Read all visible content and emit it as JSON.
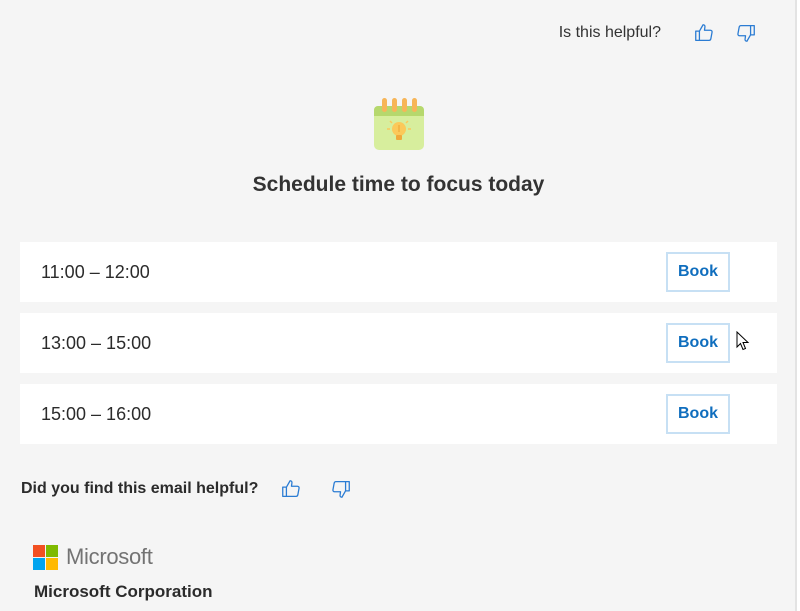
{
  "header": {
    "feedback_question": "Is this helpful?",
    "like_icon": "thumbs-up-icon",
    "dislike_icon": "thumbs-down-icon"
  },
  "hero": {
    "icon": "calendar-lightbulb-icon",
    "title": "Schedule time to focus today"
  },
  "slots": [
    {
      "time": "11:00 – 12:00",
      "action": "Book"
    },
    {
      "time": "13:00 – 15:00",
      "action": "Book"
    },
    {
      "time": "15:00 – 16:00",
      "action": "Book"
    }
  ],
  "email_feedback": {
    "question": "Did you find this email helpful?",
    "like_icon": "thumbs-up-icon",
    "dislike_icon": "thumbs-down-icon"
  },
  "footer": {
    "brand_name": "Microsoft",
    "company": "Microsoft Corporation",
    "logo_colors": [
      "#f25022",
      "#7fba00",
      "#00a4ef",
      "#ffb900"
    ]
  },
  "colors": {
    "accent": "#106ebe",
    "book_border": "#c7e0f4",
    "icon_stroke": "#2b7cd3"
  }
}
